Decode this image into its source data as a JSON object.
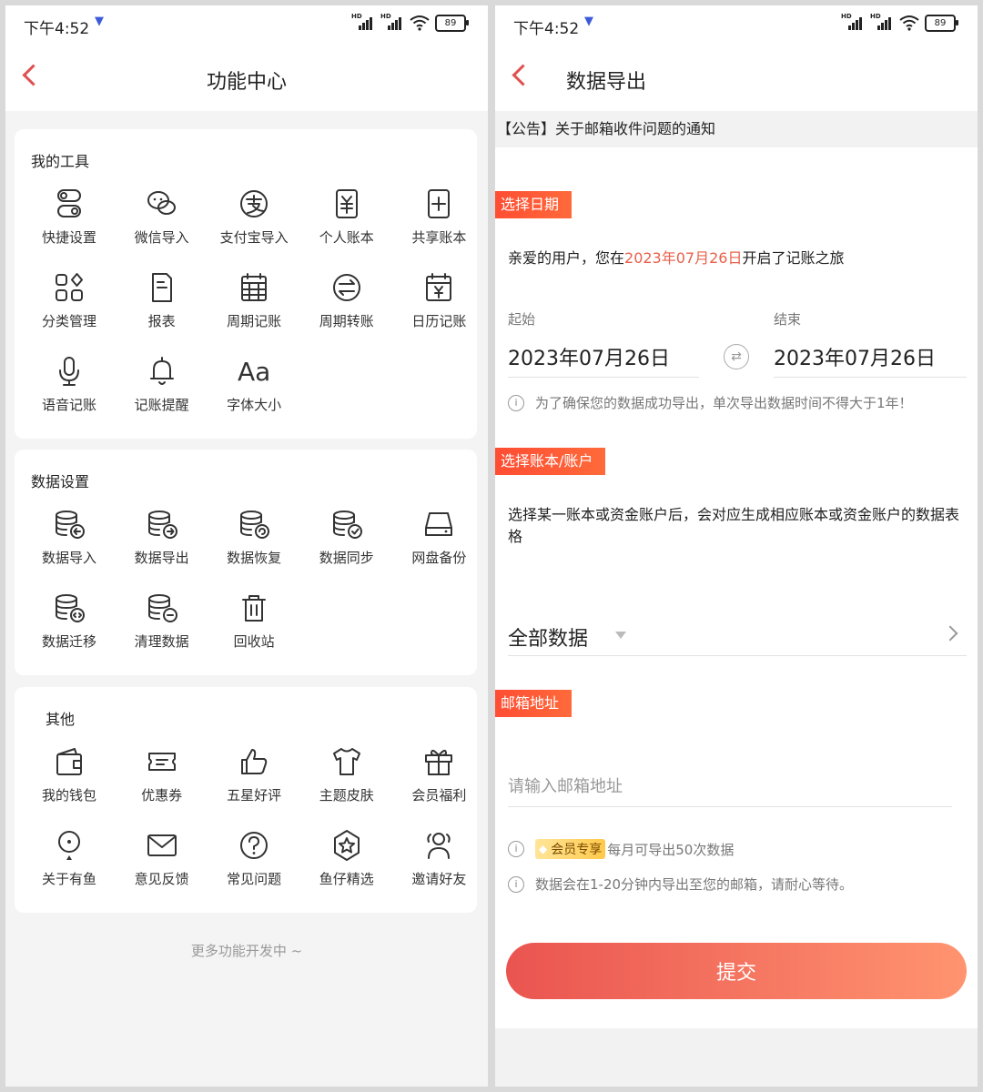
{
  "status": {
    "time": "下午4:52",
    "network": "HD",
    "battery": "89"
  },
  "left": {
    "title": "功能中心",
    "sections": [
      {
        "title": "我的工具",
        "items": [
          {
            "label": "快捷设置",
            "icon": "toggle-icon"
          },
          {
            "label": "微信导入",
            "icon": "wechat-icon"
          },
          {
            "label": "支付宝导入",
            "icon": "alipay-icon"
          },
          {
            "label": "个人账本",
            "icon": "personal-ledger-icon"
          },
          {
            "label": "共享账本",
            "icon": "shared-ledger-icon"
          },
          {
            "label": "分类管理",
            "icon": "category-icon"
          },
          {
            "label": "报表",
            "icon": "report-icon"
          },
          {
            "label": "周期记账",
            "icon": "calendar-grid-icon"
          },
          {
            "label": "周期转账",
            "icon": "transfer-icon"
          },
          {
            "label": "日历记账",
            "icon": "calendar-yen-icon"
          },
          {
            "label": "语音记账",
            "icon": "microphone-icon"
          },
          {
            "label": "记账提醒",
            "icon": "bell-icon"
          },
          {
            "label": "字体大小",
            "icon": "font-size-icon",
            "glyph": "Aa"
          }
        ]
      },
      {
        "title": "数据设置",
        "items": [
          {
            "label": "数据导入",
            "icon": "database-import-icon"
          },
          {
            "label": "数据导出",
            "icon": "database-export-icon"
          },
          {
            "label": "数据恢复",
            "icon": "database-restore-icon"
          },
          {
            "label": "数据同步",
            "icon": "database-sync-icon"
          },
          {
            "label": "网盘备份",
            "icon": "disk-backup-icon"
          },
          {
            "label": "数据迁移",
            "icon": "database-migrate-icon"
          },
          {
            "label": "清理数据",
            "icon": "database-clean-icon"
          },
          {
            "label": "回收站",
            "icon": "trash-icon"
          }
        ]
      },
      {
        "title": "其他",
        "items": [
          {
            "label": "我的钱包",
            "icon": "wallet-icon"
          },
          {
            "label": "优惠券",
            "icon": "coupon-icon"
          },
          {
            "label": "五星好评",
            "icon": "thumbs-up-icon"
          },
          {
            "label": "主题皮肤",
            "icon": "tshirt-icon"
          },
          {
            "label": "会员福利",
            "icon": "gift-icon"
          },
          {
            "label": "关于有鱼",
            "icon": "location-pin-icon"
          },
          {
            "label": "意见反馈",
            "icon": "mail-icon"
          },
          {
            "label": "常见问题",
            "icon": "question-icon"
          },
          {
            "label": "鱼仔精选",
            "icon": "star-badge-icon"
          },
          {
            "label": "邀请好友",
            "icon": "invite-friends-icon"
          }
        ]
      }
    ],
    "footer_note": "更多功能开发中 ~"
  },
  "right": {
    "title": "数据导出",
    "notice": "【公告】关于邮箱收件问题的通知",
    "date_section": {
      "tag": "选择日期",
      "intro_prefix": "亲爱的用户，您在",
      "intro_date": "2023年07月26日",
      "intro_suffix": "开启了记账之旅",
      "start_label": "起始",
      "start_value": "2023年07月26日",
      "end_label": "结束",
      "end_value": "2023年07月26日",
      "hint": "为了确保您的数据成功导出，单次导出数据时间不得大于1年！"
    },
    "ledger_section": {
      "tag": "选择账本/账户",
      "desc": "选择某一账本或资金账户后，会对应生成相应账本或资金账户的数据表格",
      "selected": "全部数据"
    },
    "email_section": {
      "tag": "邮箱地址",
      "placeholder": "请输入邮箱地址",
      "vip_badge": "会员专享",
      "vip_text": "每月可导出50次数据",
      "time_hint": "数据会在1-20分钟内导出至您的邮箱，请耐心等待。"
    },
    "submit_label": "提交"
  }
}
